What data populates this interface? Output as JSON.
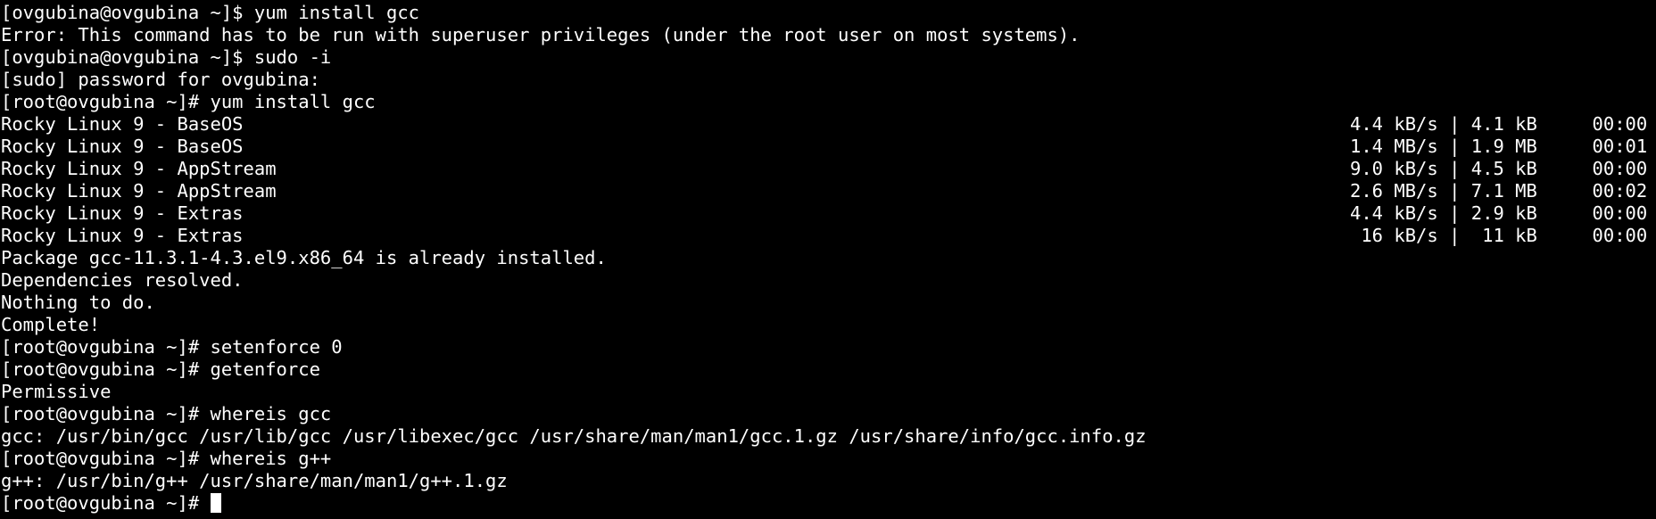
{
  "terminal": {
    "lines_before": [
      "[ovgubina@ovgubina ~]$ yum install gcc",
      "Error: This command has to be run with superuser privileges (under the root user on most systems).",
      "[ovgubina@ovgubina ~]$ sudo -i",
      "[sudo] password for ovgubina:",
      "[root@ovgubina ~]# yum install gcc"
    ],
    "repos": [
      {
        "name": "Rocky Linux 9 - BaseOS",
        "stats": "4.4 kB/s | 4.1 kB     00:00"
      },
      {
        "name": "Rocky Linux 9 - BaseOS",
        "stats": "1.4 MB/s | 1.9 MB     00:01"
      },
      {
        "name": "Rocky Linux 9 - AppStream",
        "stats": "9.0 kB/s | 4.5 kB     00:00"
      },
      {
        "name": "Rocky Linux 9 - AppStream",
        "stats": "2.6 MB/s | 7.1 MB     00:02"
      },
      {
        "name": "Rocky Linux 9 - Extras",
        "stats": "4.4 kB/s | 2.9 kB     00:00"
      },
      {
        "name": "Rocky Linux 9 - Extras",
        "stats": " 16 kB/s |  11 kB     00:00"
      }
    ],
    "lines_after": [
      "Package gcc-11.3.1-4.3.el9.x86_64 is already installed.",
      "Dependencies resolved.",
      "Nothing to do.",
      "Complete!",
      "[root@ovgubina ~]# setenforce 0",
      "[root@ovgubina ~]# getenforce",
      "Permissive",
      "[root@ovgubina ~]# whereis gcc",
      "gcc: /usr/bin/gcc /usr/lib/gcc /usr/libexec/gcc /usr/share/man/man1/gcc.1.gz /usr/share/info/gcc.info.gz",
      "[root@ovgubina ~]# whereis g++",
      "g++: /usr/bin/g++ /usr/share/man/man1/g++.1.gz"
    ],
    "prompt": "[root@ovgubina ~]# ",
    "colors": {
      "background": "#000000",
      "foreground": "#ffffff"
    }
  }
}
